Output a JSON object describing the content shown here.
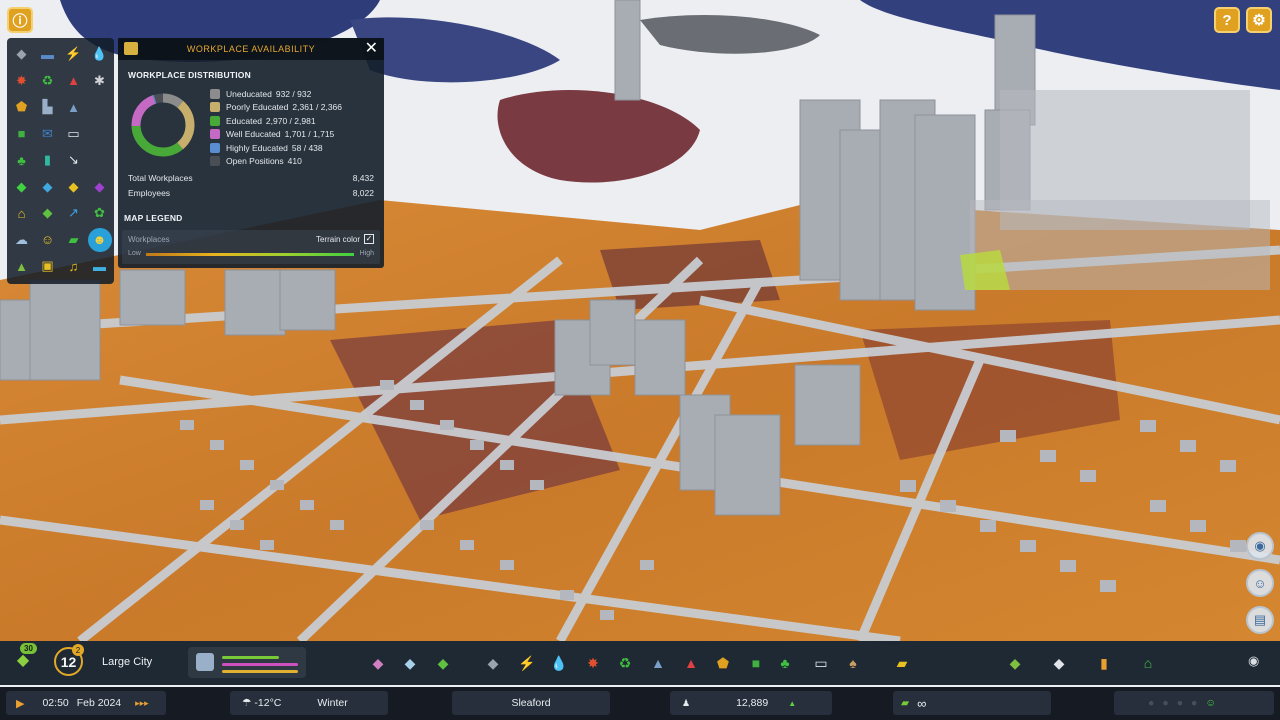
{
  "top_left_button": {
    "icon": "info-icon",
    "glyph": "ⓘ"
  },
  "top_right_buttons": [
    {
      "name": "help-button",
      "glyph": "?"
    },
    {
      "name": "settings-button",
      "glyph": "⚙"
    }
  ],
  "tool_grid": {
    "tools": [
      {
        "name": "roads-tool",
        "glyph": "◆",
        "color": "#9aa4ae"
      },
      {
        "name": "power-lines-tool",
        "glyph": "▬",
        "color": "#5a8ac8"
      },
      {
        "name": "electricity-tool",
        "glyph": "⚡",
        "color": "#f0c020"
      },
      {
        "name": "water-tool",
        "glyph": "💧",
        "color": "#40a0e0"
      },
      {
        "name": "fire-tool",
        "glyph": "✸",
        "color": "#e05030"
      },
      {
        "name": "recycle-tool",
        "glyph": "♻",
        "color": "#40c040"
      },
      {
        "name": "hazard-tool",
        "glyph": "▲",
        "color": "#e04040"
      },
      {
        "name": "wrench-tool",
        "glyph": "✱",
        "color": "#d0d4d8"
      },
      {
        "name": "police-tool",
        "glyph": "⬟",
        "color": "#e0a020"
      },
      {
        "name": "city-hall-tool",
        "glyph": "▙",
        "color": "#9ab0c8"
      },
      {
        "name": "education-tool",
        "glyph": "▲",
        "color": "#7aa0c8"
      },
      {
        "name": "spacer-1",
        "glyph": "",
        "color": "#000000"
      },
      {
        "name": "transport-tool",
        "glyph": "■",
        "color": "#40b040"
      },
      {
        "name": "mail-tool",
        "glyph": "✉",
        "color": "#4080c8"
      },
      {
        "name": "chat-tool",
        "glyph": "▭",
        "color": "#e0e4e8"
      },
      {
        "name": "spacer-2",
        "glyph": "",
        "color": "#000000"
      },
      {
        "name": "parks-tool",
        "glyph": "♣",
        "color": "#40c040"
      },
      {
        "name": "garbage-tool",
        "glyph": "▮",
        "color": "#30b8a0"
      },
      {
        "name": "pipes-tool",
        "glyph": "↘",
        "color": "#e0e4e8"
      },
      {
        "name": "spacer-3",
        "glyph": "",
        "color": "#000000"
      },
      {
        "name": "residential-zone-tool",
        "glyph": "◆",
        "color": "#40d040"
      },
      {
        "name": "commercial-zone-tool",
        "glyph": "◆",
        "color": "#40a8e0"
      },
      {
        "name": "industrial-zone-tool",
        "glyph": "◆",
        "color": "#e8c020"
      },
      {
        "name": "office-zone-tool",
        "glyph": "◆",
        "color": "#a040d0"
      },
      {
        "name": "house-tool",
        "glyph": "⌂",
        "color": "#e8c020"
      },
      {
        "name": "land-value-tool",
        "glyph": "◆",
        "color": "#60c040"
      },
      {
        "name": "trend-tool",
        "glyph": "↗",
        "color": "#40a0e0"
      },
      {
        "name": "plant-tool",
        "glyph": "✿",
        "color": "#40c040"
      },
      {
        "name": "snow-tool",
        "glyph": "☁",
        "color": "#a0c0e0"
      },
      {
        "name": "happiness-tool",
        "glyph": "☺",
        "color": "#e8c020"
      },
      {
        "name": "money-tool",
        "glyph": "▰",
        "color": "#40c040"
      },
      {
        "name": "workplace-tool",
        "glyph": "☻",
        "color": "#f0d040",
        "active": true
      },
      {
        "name": "landscape-tool",
        "glyph": "▲",
        "color": "#80c040"
      },
      {
        "name": "cargo-tool",
        "glyph": "▣",
        "color": "#e8c020"
      },
      {
        "name": "headphones-tool",
        "glyph": "♫",
        "color": "#e8c020"
      },
      {
        "name": "boat-tool",
        "glyph": "▬",
        "color": "#40b0e0"
      }
    ]
  },
  "panel": {
    "title": "WORKPLACE AVAILABILITY",
    "close_glyph": "✕",
    "distribution_title": "WORKPLACE DISTRIBUTION",
    "rows": [
      {
        "label": "Uneducated",
        "value": "932 / 932",
        "color": "#8c8c8c",
        "filled": 932
      },
      {
        "label": "Poorly Educated",
        "value": "2,361 / 2,366",
        "color": "#c8ae6c",
        "filled": 2361
      },
      {
        "label": "Educated",
        "value": "2,970 / 2,981",
        "color": "#48a838",
        "filled": 2970
      },
      {
        "label": "Well Educated",
        "value": "1,701 / 1,715",
        "color": "#c46ac4",
        "filled": 1701
      },
      {
        "label": "Highly Educated",
        "value": "58 / 438",
        "color": "#5a8ed0",
        "filled": 58
      },
      {
        "label": "Open Positions",
        "value": "410",
        "color": "#4a4f56",
        "filled": 410
      }
    ],
    "total_workplaces_label": "Total Workplaces",
    "total_workplaces_value": "8,432",
    "employees_label": "Employees",
    "employees_value": "8,022",
    "map_legend_title": "MAP LEGEND",
    "workplaces_label": "Workplaces",
    "terrain_label": "Terrain color",
    "terrain_checked": "✓",
    "low_label": "Low",
    "high_label": "High"
  },
  "side_buttons": [
    {
      "name": "notification-button",
      "glyph": "◉"
    },
    {
      "name": "citizen-button",
      "glyph": "☺"
    },
    {
      "name": "log-button",
      "glyph": "▤"
    }
  ],
  "toolbar": {
    "population_badge": "30",
    "milestone_level": "12",
    "milestone_badge": "2",
    "city_size": "Large City",
    "meters": [
      {
        "color": "#78c838",
        "fill": 0.75
      },
      {
        "color": "#d050c0",
        "fill": 1.0
      },
      {
        "color": "#e0b030",
        "fill": 1.0
      }
    ],
    "tools": [
      {
        "name": "zoning-button",
        "glyph": "◆",
        "color": "#d080c0"
      },
      {
        "name": "areas-button",
        "glyph": "◆",
        "color": "#a8d0e8"
      },
      {
        "name": "landscaping-button",
        "glyph": "◆",
        "color": "#60c040"
      },
      {
        "name": "roads-button",
        "glyph": "◆",
        "color": "#9aa4ae"
      },
      {
        "name": "electricity-button",
        "glyph": "⚡",
        "color": "#f0c020"
      },
      {
        "name": "water-button",
        "glyph": "💧",
        "color": "#40a0e0"
      },
      {
        "name": "healthcare-button",
        "glyph": "✸",
        "color": "#e05030"
      },
      {
        "name": "garbage-button",
        "glyph": "♻",
        "color": "#40c040"
      },
      {
        "name": "education-button",
        "glyph": "▲",
        "color": "#7aa0c8"
      },
      {
        "name": "fire-button",
        "glyph": "▲",
        "color": "#e04040"
      },
      {
        "name": "police-button",
        "glyph": "⬟",
        "color": "#e0a020"
      },
      {
        "name": "transportation-button",
        "glyph": "■",
        "color": "#40b040"
      },
      {
        "name": "parks-button",
        "glyph": "♣",
        "color": "#40c040"
      },
      {
        "name": "communications-button",
        "glyph": "▭",
        "color": "#e0e4e8"
      },
      {
        "name": "landscape-tools-button",
        "glyph": "♠",
        "color": "#c8a060"
      },
      {
        "name": "bulldozer-button",
        "glyph": "▰",
        "color": "#e8c020"
      },
      {
        "name": "transport-overview-button",
        "glyph": "◆",
        "color": "#80c040"
      },
      {
        "name": "map-button",
        "glyph": "◆",
        "color": "#e0e4e8"
      },
      {
        "name": "statistics-button",
        "glyph": "▮",
        "color": "#e8a030"
      },
      {
        "name": "city-services-button",
        "glyph": "⌂",
        "color": "#40c040"
      }
    ],
    "camera_glyph": "◉"
  },
  "statusbar": {
    "play_glyph": "▶",
    "time": "02:50",
    "date": "Feb 2024",
    "speed_glyph": "▸▸▸",
    "weather_glyph": "☂",
    "temperature": "-12°C",
    "season": "Winter",
    "city_name": "Sleaford",
    "population": "12,889",
    "population_trend": "▲",
    "money": "∞",
    "happiness_glyph": "☺"
  },
  "colors": {
    "accent": "#e2a828",
    "panel_bg": "#141e2a",
    "snow": "#f2f2f4",
    "water": "#2c3a78",
    "ground_orange": "#d4802c",
    "ground_purple": "#6a3440"
  }
}
